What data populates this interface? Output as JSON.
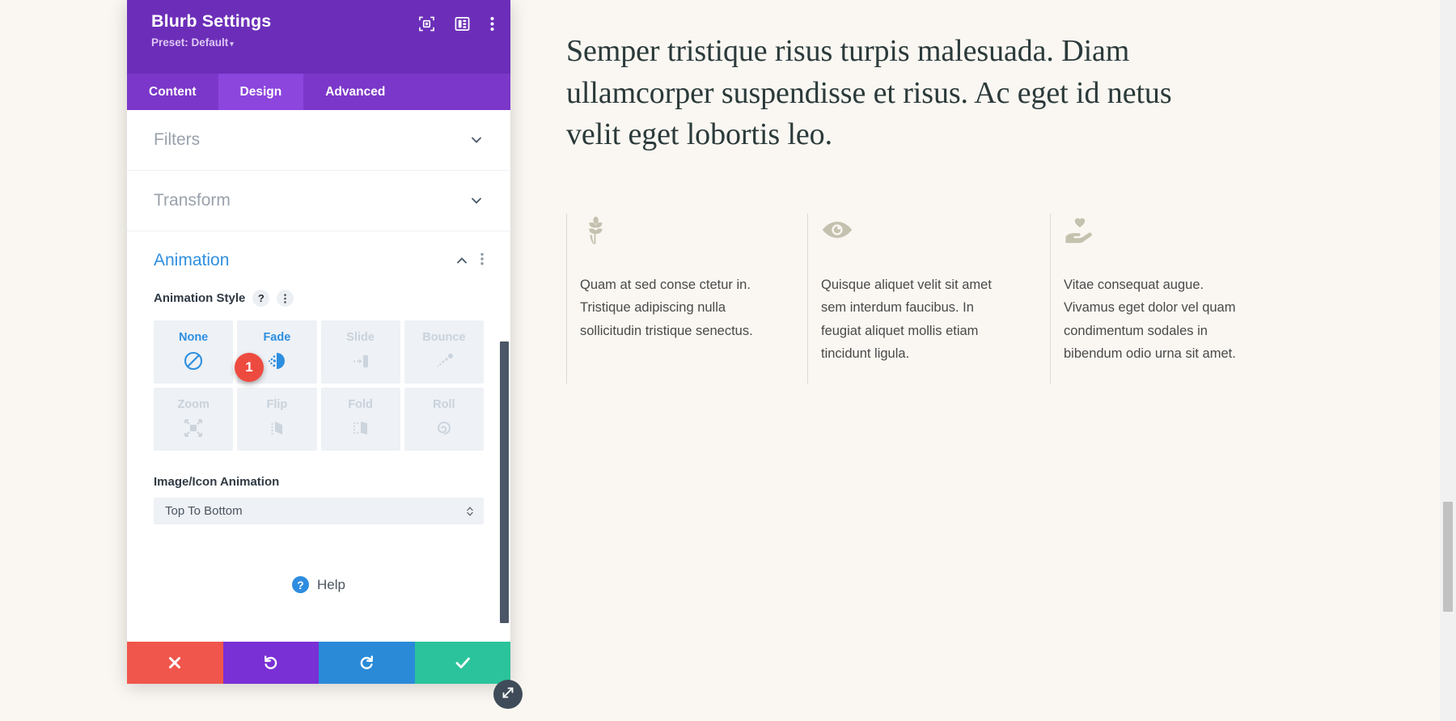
{
  "modal": {
    "title": "Blurb Settings",
    "preset": "Preset: Default",
    "preset_caret": "▾",
    "head_icons": [
      {
        "name": "focus-icon",
        "label": "focus"
      },
      {
        "name": "layout-icon",
        "label": "layout"
      },
      {
        "name": "more-options-icon",
        "label": "more"
      }
    ],
    "tabs": [
      {
        "label": "Content",
        "active": false
      },
      {
        "label": "Design",
        "active": true
      },
      {
        "label": "Advanced",
        "active": false
      }
    ],
    "sections": [
      {
        "label": "Filters",
        "expanded": false
      },
      {
        "label": "Transform",
        "expanded": false
      },
      {
        "label": "Animation",
        "expanded": true
      }
    ],
    "animation": {
      "style_label": "Animation Style",
      "help_glyph": "?",
      "options": [
        {
          "label": "None",
          "selected": true,
          "icon": "no-entry-icon"
        },
        {
          "label": "Fade",
          "selected": true,
          "icon": "fade-icon"
        },
        {
          "label": "Slide",
          "selected": false,
          "icon": "slide-icon"
        },
        {
          "label": "Bounce",
          "selected": false,
          "icon": "bounce-icon"
        },
        {
          "label": "Zoom",
          "selected": false,
          "icon": "zoom-icon"
        },
        {
          "label": "Flip",
          "selected": false,
          "icon": "flip-icon"
        },
        {
          "label": "Fold",
          "selected": false,
          "icon": "fold-icon"
        },
        {
          "label": "Roll",
          "selected": false,
          "icon": "roll-icon"
        }
      ],
      "annotation_badge": "1",
      "image_icon_animation_label": "Image/Icon Animation",
      "image_icon_animation_value": "Top To Bottom"
    },
    "help": {
      "glyph": "?",
      "label": "Help"
    },
    "footer": [
      {
        "name": "cancel-button",
        "icon": "close-icon"
      },
      {
        "name": "undo-button",
        "icon": "undo-icon"
      },
      {
        "name": "redo-button",
        "icon": "redo-icon"
      },
      {
        "name": "save-button",
        "icon": "check-icon"
      }
    ]
  },
  "content": {
    "heading": "Semper tristique risus turpis malesuada. Diam ullamcorper suspendisse et risus. Ac eget id netus velit eget lobortis leo.",
    "blurbs": [
      {
        "icon": "leaf-icon",
        "text": "Quam at sed conse ctetur in. Tristique adipiscing nulla sollicitudin tristique senectus."
      },
      {
        "icon": "eye-icon",
        "text": "Quisque aliquet velit sit amet sem interdum faucibus. In feugiat aliquet mollis etiam tincidunt ligula."
      },
      {
        "icon": "heart-hand-icon",
        "text": "Vitae consequat augue. Vivamus eget dolor vel quam condimentum sodales in bibendum odio urna sit amet."
      }
    ]
  },
  "colors": {
    "modal_header": "#6c2eb9",
    "tab_bar": "#7b37c9",
    "tab_active": "#8c45dd",
    "accent_blue": "#2d8fe0",
    "badge_red": "#ee4b40",
    "cancel": "#f0564c",
    "undo": "#7930d4",
    "redo": "#2a8ad8",
    "save": "#2bc39b",
    "page_bg": "#faf7f2"
  }
}
